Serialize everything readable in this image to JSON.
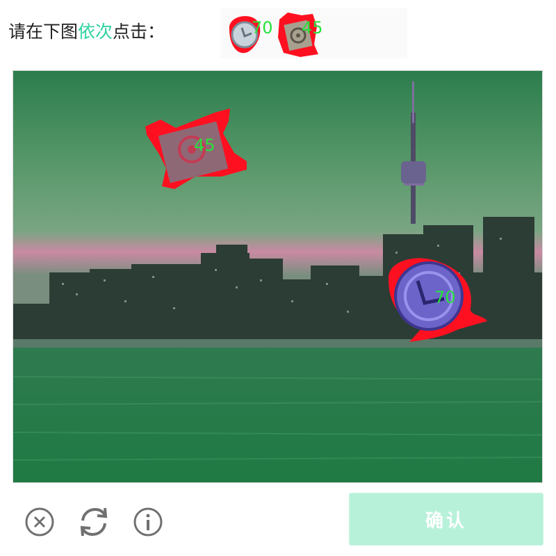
{
  "prompt": {
    "prefix": "请在下图",
    "highlight": "依次",
    "suffix": "点击："
  },
  "targets": [
    {
      "icon": "clock-icon",
      "label": "70"
    },
    {
      "icon": "target-icon",
      "label": "45"
    }
  ],
  "markers": [
    {
      "icon": "target-icon",
      "label": "45"
    },
    {
      "icon": "clock-icon",
      "label": "70"
    }
  ],
  "footer": {
    "close_icon": "close-circle-icon",
    "refresh_icon": "refresh-icon",
    "info_icon": "info-icon",
    "confirm_label": "确认"
  },
  "colors": {
    "highlight": "#2fd3a0",
    "marker_outline": "#ff1020",
    "marker_number": "#27e33b",
    "confirm_bg": "#b8f1da"
  }
}
